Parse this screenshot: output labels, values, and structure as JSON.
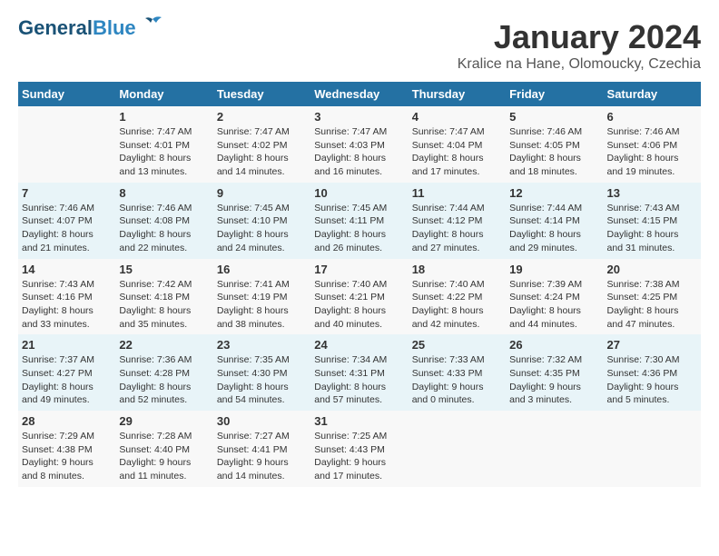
{
  "header": {
    "logo_line1": "General",
    "logo_line2": "Blue",
    "month_title": "January 2024",
    "location": "Kralice na Hane, Olomoucky, Czechia"
  },
  "weekdays": [
    "Sunday",
    "Monday",
    "Tuesday",
    "Wednesday",
    "Thursday",
    "Friday",
    "Saturday"
  ],
  "weeks": [
    [
      {
        "day": "",
        "info": ""
      },
      {
        "day": "1",
        "info": "Sunrise: 7:47 AM\nSunset: 4:01 PM\nDaylight: 8 hours\nand 13 minutes."
      },
      {
        "day": "2",
        "info": "Sunrise: 7:47 AM\nSunset: 4:02 PM\nDaylight: 8 hours\nand 14 minutes."
      },
      {
        "day": "3",
        "info": "Sunrise: 7:47 AM\nSunset: 4:03 PM\nDaylight: 8 hours\nand 16 minutes."
      },
      {
        "day": "4",
        "info": "Sunrise: 7:47 AM\nSunset: 4:04 PM\nDaylight: 8 hours\nand 17 minutes."
      },
      {
        "day": "5",
        "info": "Sunrise: 7:46 AM\nSunset: 4:05 PM\nDaylight: 8 hours\nand 18 minutes."
      },
      {
        "day": "6",
        "info": "Sunrise: 7:46 AM\nSunset: 4:06 PM\nDaylight: 8 hours\nand 19 minutes."
      }
    ],
    [
      {
        "day": "7",
        "info": "Sunrise: 7:46 AM\nSunset: 4:07 PM\nDaylight: 8 hours\nand 21 minutes."
      },
      {
        "day": "8",
        "info": "Sunrise: 7:46 AM\nSunset: 4:08 PM\nDaylight: 8 hours\nand 22 minutes."
      },
      {
        "day": "9",
        "info": "Sunrise: 7:45 AM\nSunset: 4:10 PM\nDaylight: 8 hours\nand 24 minutes."
      },
      {
        "day": "10",
        "info": "Sunrise: 7:45 AM\nSunset: 4:11 PM\nDaylight: 8 hours\nand 26 minutes."
      },
      {
        "day": "11",
        "info": "Sunrise: 7:44 AM\nSunset: 4:12 PM\nDaylight: 8 hours\nand 27 minutes."
      },
      {
        "day": "12",
        "info": "Sunrise: 7:44 AM\nSunset: 4:14 PM\nDaylight: 8 hours\nand 29 minutes."
      },
      {
        "day": "13",
        "info": "Sunrise: 7:43 AM\nSunset: 4:15 PM\nDaylight: 8 hours\nand 31 minutes."
      }
    ],
    [
      {
        "day": "14",
        "info": "Sunrise: 7:43 AM\nSunset: 4:16 PM\nDaylight: 8 hours\nand 33 minutes."
      },
      {
        "day": "15",
        "info": "Sunrise: 7:42 AM\nSunset: 4:18 PM\nDaylight: 8 hours\nand 35 minutes."
      },
      {
        "day": "16",
        "info": "Sunrise: 7:41 AM\nSunset: 4:19 PM\nDaylight: 8 hours\nand 38 minutes."
      },
      {
        "day": "17",
        "info": "Sunrise: 7:40 AM\nSunset: 4:21 PM\nDaylight: 8 hours\nand 40 minutes."
      },
      {
        "day": "18",
        "info": "Sunrise: 7:40 AM\nSunset: 4:22 PM\nDaylight: 8 hours\nand 42 minutes."
      },
      {
        "day": "19",
        "info": "Sunrise: 7:39 AM\nSunset: 4:24 PM\nDaylight: 8 hours\nand 44 minutes."
      },
      {
        "day": "20",
        "info": "Sunrise: 7:38 AM\nSunset: 4:25 PM\nDaylight: 8 hours\nand 47 minutes."
      }
    ],
    [
      {
        "day": "21",
        "info": "Sunrise: 7:37 AM\nSunset: 4:27 PM\nDaylight: 8 hours\nand 49 minutes."
      },
      {
        "day": "22",
        "info": "Sunrise: 7:36 AM\nSunset: 4:28 PM\nDaylight: 8 hours\nand 52 minutes."
      },
      {
        "day": "23",
        "info": "Sunrise: 7:35 AM\nSunset: 4:30 PM\nDaylight: 8 hours\nand 54 minutes."
      },
      {
        "day": "24",
        "info": "Sunrise: 7:34 AM\nSunset: 4:31 PM\nDaylight: 8 hours\nand 57 minutes."
      },
      {
        "day": "25",
        "info": "Sunrise: 7:33 AM\nSunset: 4:33 PM\nDaylight: 9 hours\nand 0 minutes."
      },
      {
        "day": "26",
        "info": "Sunrise: 7:32 AM\nSunset: 4:35 PM\nDaylight: 9 hours\nand 3 minutes."
      },
      {
        "day": "27",
        "info": "Sunrise: 7:30 AM\nSunset: 4:36 PM\nDaylight: 9 hours\nand 5 minutes."
      }
    ],
    [
      {
        "day": "28",
        "info": "Sunrise: 7:29 AM\nSunset: 4:38 PM\nDaylight: 9 hours\nand 8 minutes."
      },
      {
        "day": "29",
        "info": "Sunrise: 7:28 AM\nSunset: 4:40 PM\nDaylight: 9 hours\nand 11 minutes."
      },
      {
        "day": "30",
        "info": "Sunrise: 7:27 AM\nSunset: 4:41 PM\nDaylight: 9 hours\nand 14 minutes."
      },
      {
        "day": "31",
        "info": "Sunrise: 7:25 AM\nSunset: 4:43 PM\nDaylight: 9 hours\nand 17 minutes."
      },
      {
        "day": "",
        "info": ""
      },
      {
        "day": "",
        "info": ""
      },
      {
        "day": "",
        "info": ""
      }
    ]
  ]
}
